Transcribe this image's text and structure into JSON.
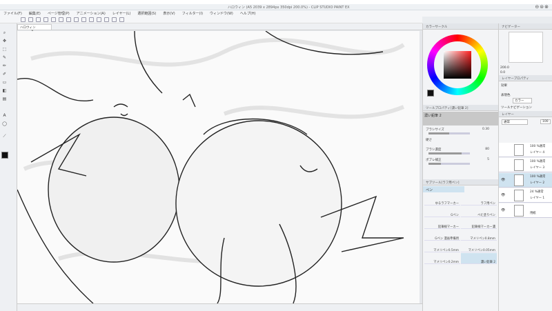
{
  "window": {
    "title": "ハロウィン (A5 2039 x 2894px 350dpi 200.0%) - CLIP STUDIO PAINT EX",
    "controls": "⊖⊜⊗"
  },
  "menu": [
    "ファイル(F)",
    "編集(E)",
    "ページ管理(P)",
    "アニメーション(A)",
    "レイヤー(L)",
    "選択範囲(S)",
    "表示(V)",
    "フィルター(I)",
    "ウィンドウ(W)",
    "ヘルプ(H)"
  ],
  "document_tab": {
    "label": "ハロウィン",
    "close": "×"
  },
  "color_panel": {
    "tab": "カラーサークル",
    "main_color": "#111111",
    "sub_color": "#ffffff",
    "hue_color": "#ff2020"
  },
  "tool_property": {
    "tab": "ツールプロパティ[濃い鉛筆 2]",
    "tool_name": "濃い鉛筆 2",
    "rows": [
      {
        "label": "ブラシサイズ",
        "value": "0.30",
        "fill": 0.5
      },
      {
        "label": "硬さ",
        "value": "",
        "fill": 0.6
      },
      {
        "label": "ブラシ濃度",
        "value": "80",
        "fill": 0.8
      },
      {
        "label": "ポブレ補正",
        "value": "5",
        "fill": 0.3
      }
    ]
  },
  "sub_tool": {
    "tab": "サブツール[ラフ用ペン]",
    "group": "ペン",
    "brushes": [
      "ゆるラフマーカー",
      "ラフ用ペン",
      "Gペン",
      "べた塗りペン",
      "鉛筆線マーカー",
      "鉛筆線マーカー濃",
      "Gペン 漫画準備用",
      "マメリペン0.8mm",
      "マメリペン0.5mm",
      "マメリペン0.05mm",
      "マメリペン0.2mm",
      "濃い鉛筆 2"
    ],
    "selected": 11
  },
  "navigator": {
    "tab": "ナビゲーター",
    "zoom": "200.0",
    "angle": "0.0"
  },
  "layer_property": {
    "tab": "レイヤープロパティ",
    "effect_label": "効果",
    "color_label": "表現色",
    "color_value": "カラー",
    "tool_nav": "ツールナビゲーション"
  },
  "layer_panel": {
    "tab": "レイヤー",
    "blend": "通常",
    "opacity": "100",
    "layers": [
      {
        "mode": "100 %通常",
        "name": "レイヤー 4",
        "visible": false,
        "selected": false
      },
      {
        "mode": "100 %通常",
        "name": "レイヤー 3",
        "visible": false,
        "selected": false
      },
      {
        "mode": "100 %通常",
        "name": "レイヤー 2",
        "visible": true,
        "selected": true
      },
      {
        "mode": "24 %通常",
        "name": "レイヤー 1",
        "visible": true,
        "selected": false
      },
      {
        "mode": "",
        "name": "用紙",
        "visible": true,
        "selected": false
      }
    ]
  }
}
